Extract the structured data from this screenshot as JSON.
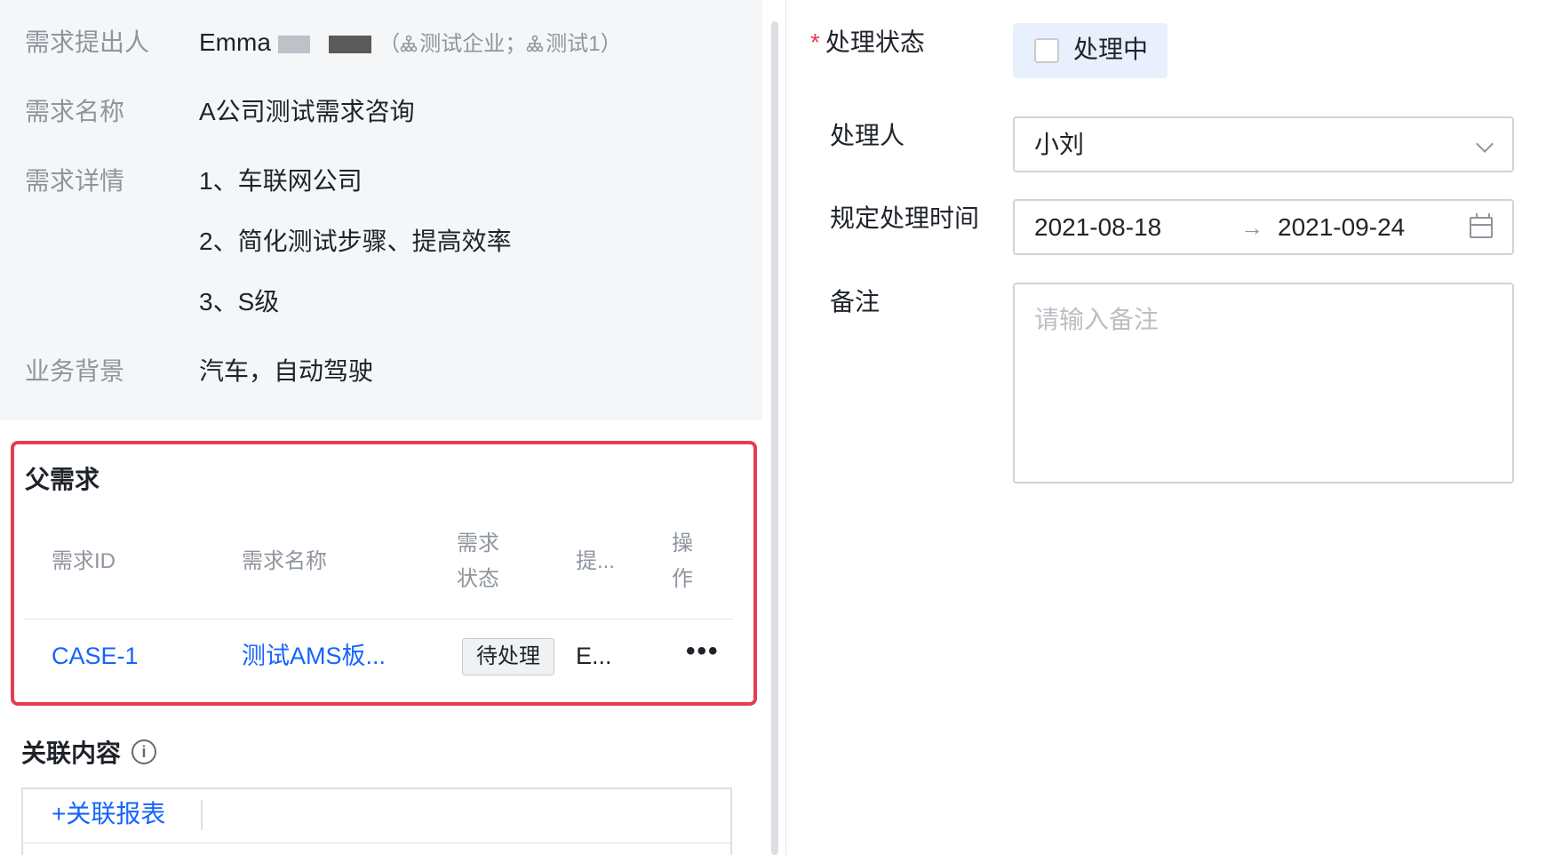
{
  "requirement_info": {
    "proposer_label": "需求提出人",
    "proposer_name": "Emma",
    "proposer_orgs": "测试企业；",
    "proposer_orgs_2": "测试1）",
    "name_label": "需求名称",
    "name_value": "A公司测试需求咨询",
    "detail_label": "需求详情",
    "detail_lines": [
      "1、车联网公司",
      "2、简化测试步骤、提高效率",
      "3、S级"
    ],
    "background_label": "业务背景",
    "background_value": "汽车，自动驾驶"
  },
  "parent_requirement": {
    "title": "父需求",
    "columns": {
      "id": "需求ID",
      "name": "需求名称",
      "status_line1": "需求",
      "status_line2": "状态",
      "proposer": "提...",
      "action_line1": "操",
      "action_line2": "作"
    },
    "rows": [
      {
        "id": "CASE-1",
        "name": "测试AMS板...",
        "status": "待处理",
        "proposer": "E...",
        "action": "•••"
      }
    ]
  },
  "related_content": {
    "title": "关联内容",
    "info_icon": "info-icon",
    "add_label": "+关联报表"
  },
  "form": {
    "status_label": "处理状态",
    "required_mark": "*",
    "status_checkbox_label": "处理中",
    "status_checked": false,
    "handler_label": "处理人",
    "handler_value": "小刘",
    "deadline_label": "规定处理时间",
    "deadline_start": "2021-08-18",
    "deadline_arrow": "→",
    "deadline_end": "2021-09-24",
    "remark_label": "备注",
    "remark_placeholder": "请输入备注"
  },
  "colors": {
    "accent_blue": "#1664ff",
    "highlight_red": "#e53e4e",
    "label_gray": "#8f959e",
    "panel_bg": "#f5f6f7",
    "status_bg": "#e8f0fd"
  }
}
